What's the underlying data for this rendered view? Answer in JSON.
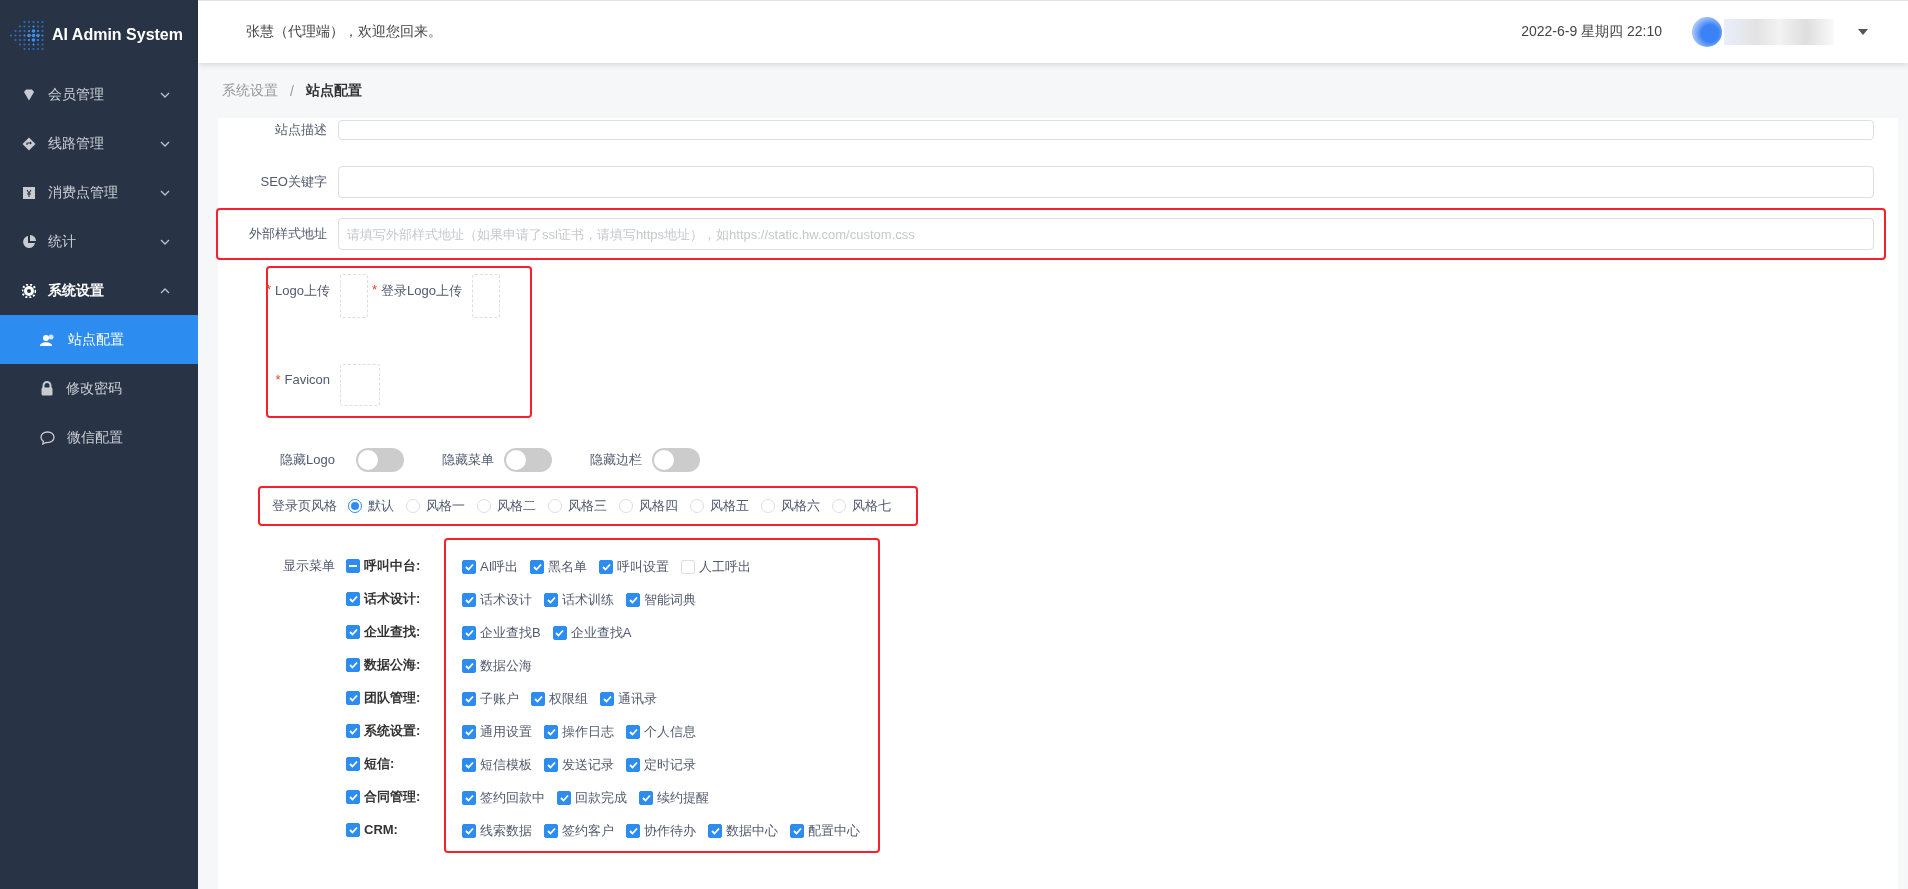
{
  "sidebar": {
    "brand": "AI Admin System",
    "items": [
      {
        "label": "会员管理",
        "kind": "gem",
        "expanded": false
      },
      {
        "label": "线路管理",
        "kind": "route",
        "expanded": false
      },
      {
        "label": "消费点管理",
        "kind": "ledger",
        "expanded": false
      },
      {
        "label": "统计",
        "kind": "pie",
        "expanded": false
      },
      {
        "label": "系统设置",
        "kind": "gear",
        "expanded": true,
        "children": [
          {
            "label": "站点配置",
            "kind": "users",
            "selected": true
          },
          {
            "label": "修改密码",
            "kind": "lock",
            "selected": false
          },
          {
            "label": "微信配置",
            "kind": "chat",
            "selected": false
          }
        ]
      }
    ]
  },
  "header": {
    "greeting": "张慧（代理端），欢迎您回来。",
    "datetime": "2022-6-9 星期四 22:10"
  },
  "breadcrumb": {
    "separator": "/",
    "items": [
      "系统设置",
      "站点配置"
    ]
  },
  "fields": [
    {
      "label": "站点描述",
      "highlighted": false
    },
    {
      "label": "SEO关键字",
      "highlighted": false
    },
    {
      "label": "外部样式地址",
      "placeholder": "请填写外部样式地址（如果申请了ssl证书，请填写https地址），如https://static.hw.com/custom.css",
      "highlighted": true
    }
  ],
  "uploads": {
    "highlighted": true,
    "items": [
      {
        "label": "Logo上传",
        "mark": "*"
      },
      {
        "label": "登录Logo上传",
        "mark": "*"
      },
      {
        "label": "Favicon",
        "mark": "*"
      }
    ]
  },
  "toggles": [
    {
      "label": "隐藏Logo",
      "on": false
    },
    {
      "label": "隐藏菜单",
      "on": false
    },
    {
      "label": "隐藏边栏",
      "on": false
    }
  ],
  "login_style": {
    "label": "登录页风格",
    "highlighted": true,
    "options": [
      {
        "label": "默认",
        "selected": true
      },
      {
        "label": "风格一",
        "selected": false
      },
      {
        "label": "风格二",
        "selected": false
      },
      {
        "label": "风格三",
        "selected": false
      },
      {
        "label": "风格四",
        "selected": false
      },
      {
        "label": "风格五",
        "selected": false
      },
      {
        "label": "风格六",
        "selected": false
      },
      {
        "label": "风格七",
        "selected": false
      }
    ]
  },
  "menu": {
    "label": "显示菜单",
    "highlighted": true,
    "groups": [
      {
        "label": "呼叫中台:",
        "checked": false,
        "indeterminate": true,
        "items": [
          {
            "label": "AI呼出",
            "checked": true
          },
          {
            "label": "黑名单",
            "checked": true
          },
          {
            "label": "呼叫设置",
            "checked": true
          },
          {
            "label": "人工呼出",
            "checked": false
          }
        ]
      },
      {
        "label": "话术设计:",
        "checked": true,
        "indeterminate": false,
        "items": [
          {
            "label": "话术设计",
            "checked": true
          },
          {
            "label": "话术训练",
            "checked": true
          },
          {
            "label": "智能词典",
            "checked": true
          }
        ]
      },
      {
        "label": "企业查找:",
        "checked": true,
        "indeterminate": false,
        "items": [
          {
            "label": "企业查找B",
            "checked": true
          },
          {
            "label": "企业查找A",
            "checked": true
          }
        ]
      },
      {
        "label": "数据公海:",
        "checked": true,
        "indeterminate": false,
        "items": [
          {
            "label": "数据公海",
            "checked": true
          }
        ]
      },
      {
        "label": "团队管理:",
        "checked": true,
        "indeterminate": false,
        "items": [
          {
            "label": "子账户",
            "checked": true
          },
          {
            "label": "权限组",
            "checked": true
          },
          {
            "label": "通讯录",
            "checked": true
          }
        ]
      },
      {
        "label": "系统设置:",
        "checked": true,
        "indeterminate": false,
        "items": [
          {
            "label": "通用设置",
            "checked": true
          },
          {
            "label": "操作日志",
            "checked": true
          },
          {
            "label": "个人信息",
            "checked": true
          }
        ]
      },
      {
        "label": "短信:",
        "checked": true,
        "indeterminate": false,
        "items": [
          {
            "label": "短信模板",
            "checked": true
          },
          {
            "label": "发送记录",
            "checked": true
          },
          {
            "label": "定时记录",
            "checked": true
          }
        ]
      },
      {
        "label": "合同管理:",
        "checked": true,
        "indeterminate": false,
        "items": [
          {
            "label": "签约回款中",
            "checked": true
          },
          {
            "label": "回款完成",
            "checked": true
          },
          {
            "label": "续约提醒",
            "checked": true
          }
        ]
      },
      {
        "label": "CRM:",
        "checked": true,
        "indeterminate": false,
        "items": [
          {
            "label": "线索数据",
            "checked": true
          },
          {
            "label": "签约客户",
            "checked": true
          },
          {
            "label": "协作待办",
            "checked": true
          },
          {
            "label": "数据中心",
            "checked": true
          },
          {
            "label": "配置中心",
            "checked": true
          }
        ]
      }
    ]
  }
}
